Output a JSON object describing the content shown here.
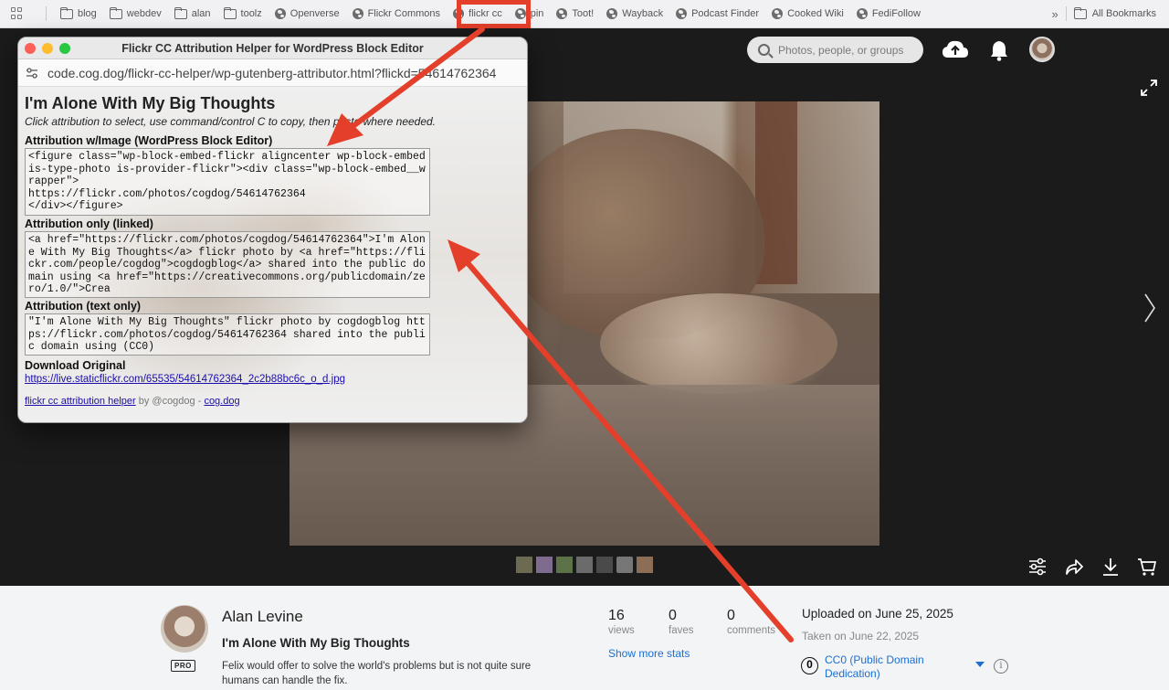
{
  "bookmarks": {
    "items": [
      {
        "label": "blog",
        "icon": "folder-icon"
      },
      {
        "label": "webdev",
        "icon": "folder-icon"
      },
      {
        "label": "alan",
        "icon": "folder-icon"
      },
      {
        "label": "toolz",
        "icon": "folder-icon"
      },
      {
        "label": "Openverse",
        "icon": "globe-icon"
      },
      {
        "label": "Flickr Commons",
        "icon": "globe-icon"
      },
      {
        "label": "flickr cc",
        "icon": "globe-icon"
      },
      {
        "label": "pin",
        "icon": "globe-icon"
      },
      {
        "label": "Toot!",
        "icon": "globe-icon"
      },
      {
        "label": "Wayback",
        "icon": "globe-icon"
      },
      {
        "label": "Podcast Finder",
        "icon": "globe-icon"
      },
      {
        "label": "Cooked Wiki",
        "icon": "globe-icon"
      },
      {
        "label": "FediFollow",
        "icon": "globe-icon"
      }
    ],
    "more": "»",
    "all_bookmarks": "All Bookmarks"
  },
  "header": {
    "search_placeholder": "Photos, people, or groups"
  },
  "popup": {
    "window_title": "Flickr CC Attribution Helper for WordPress Block Editor",
    "url": "code.cog.dog/flickr-cc-helper/wp-gutenberg-attributor.html?flickd=54614762364",
    "heading": "I'm Alone With My Big Thoughts",
    "subtitle": "Click attribution to select, use command/control C to copy, then paste where needed.",
    "label_image": "Attribution w/Image (WordPress Block Editor)",
    "code_image": "<figure class=\"wp-block-embed-flickr aligncenter wp-block-embed is-type-photo is-provider-flickr\"><div class=\"wp-block-embed__wrapper\">\nhttps://flickr.com/photos/cogdog/54614762364\n</div></figure>",
    "label_linked": "Attribution only (linked)",
    "code_linked": "<a href=\"https://flickr.com/photos/cogdog/54614762364\">I'm Alone With My Big Thoughts</a> flickr photo by <a href=\"https://flickr.com/people/cogdog\">cogdogblog</a> shared into the public domain using <a href=\"https://creativecommons.org/publicdomain/zero/1.0/\">Crea",
    "label_text": "Attribution (text only)",
    "code_text": "\"I'm Alone With My Big Thoughts\" flickr photo by cogdogblog https://flickr.com/photos/cogdog/54614762364 shared into the public domain using (CC0)",
    "label_download": "Download Original",
    "download_link": "https://live.staticflickr.com/65535/54614762364_2c2b88bc6c_o_d.jpg",
    "footer_link": "flickr cc attribution helper",
    "footer_by": " by @cogdog - ",
    "footer_site": "cog.dog"
  },
  "info": {
    "user_name": "Alan Levine",
    "pro_badge": "PRO",
    "photo_title": "I'm Alone With My Big Thoughts",
    "description": "Felix would offer to solve the world's problems but is not quite sure humans can handle the fix.",
    "stats": [
      {
        "num": "16",
        "label": "views"
      },
      {
        "num": "0",
        "label": "faves"
      },
      {
        "num": "0",
        "label": "comments"
      }
    ],
    "show_more_stats": "Show more stats",
    "uploaded": "Uploaded on June 25, 2025",
    "taken": "Taken on June 22, 2025",
    "license_icon": "0",
    "license": "CC0 (Public Domain Dedication)",
    "info_icon": "i"
  },
  "colors": {
    "annotation_red": "#e43f2a",
    "flickr_link": "#1c6fd1"
  }
}
